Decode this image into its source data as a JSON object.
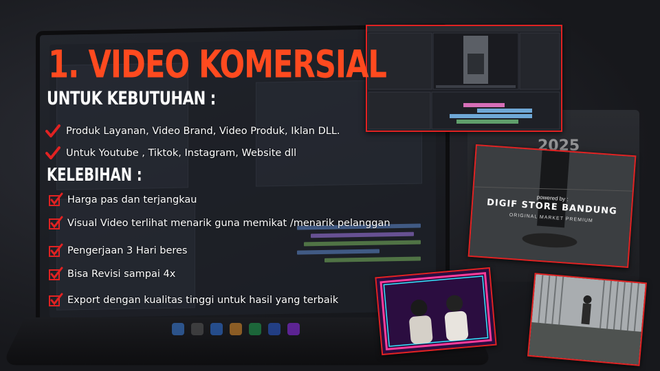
{
  "title": "1. VIDEO KOMERSIAL",
  "needs_heading": "UNTUK KEBUTUHAN :",
  "needs": [
    "Produk Layanan, Video Brand, Video Produk, Iklan DLL.",
    "Untuk Youtube , Tiktok, Instagram, Website dll"
  ],
  "advantages_heading": "KELEBIHAN :",
  "advantages": [
    "Harga pas dan terjangkau",
    "Visual Video terlihat menarik guna memikat /menarik pelanggan",
    "Pengerjaan 3 Hari beres",
    "Bisa Revisi sampai 4x",
    "Export dengan kualitas tinggi untuk hasil yang terbaik"
  ],
  "calendar_year": "2025",
  "thumbnail_digif": {
    "small": "powered by :",
    "main": "DIGIF STORE BANDUNG",
    "sub": "ORIGINAL MARKET PREMIUM"
  },
  "colors": {
    "accent": "#ff4a1f",
    "check": "#e12222",
    "frame": "#e12222",
    "neon_pink": "#ff3c9a",
    "neon_cyan": "#35e6ff"
  },
  "icons": {
    "check": "check-icon",
    "checkbox": "checkbox-checked-icon"
  }
}
